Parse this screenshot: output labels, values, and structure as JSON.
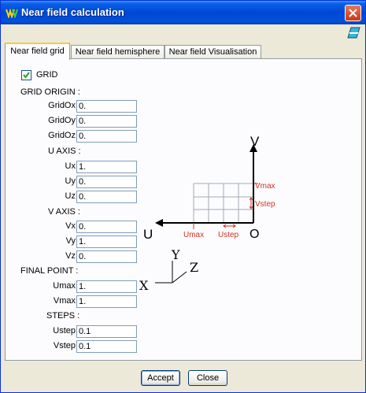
{
  "window": {
    "title": "Near field calculation"
  },
  "tabs": [
    {
      "label": "Near field grid"
    },
    {
      "label": "Near field hemisphere"
    },
    {
      "label": "Near field Visualisation"
    }
  ],
  "grid_checkbox": {
    "label": "GRID",
    "checked": true
  },
  "grid_origin": {
    "heading": "GRID ORIGIN  :",
    "fields": [
      {
        "label": "GridOx",
        "value": "0."
      },
      {
        "label": "GridOy",
        "value": "0."
      },
      {
        "label": "GridOz",
        "value": "0."
      }
    ]
  },
  "u_axis": {
    "heading": "U AXIS  :",
    "fields": [
      {
        "label": "Ux",
        "value": "1."
      },
      {
        "label": "Uy",
        "value": "0."
      },
      {
        "label": "Uz",
        "value": "0."
      }
    ]
  },
  "v_axis": {
    "heading": "V AXIS  :",
    "fields": [
      {
        "label": "Vx",
        "value": "0."
      },
      {
        "label": "Vy",
        "value": "1."
      },
      {
        "label": "Vz",
        "value": "0."
      }
    ]
  },
  "final_point": {
    "heading": "FINAL POINT  :",
    "fields": [
      {
        "label": "Umax",
        "value": "1."
      },
      {
        "label": "Vmax",
        "value": "1."
      }
    ]
  },
  "steps": {
    "heading": "STEPS  :",
    "fields": [
      {
        "label": "Ustep",
        "value": "0.1"
      },
      {
        "label": "Vstep",
        "value": "0.1"
      }
    ]
  },
  "diagram": {
    "v_label": "V",
    "u_label": "U",
    "o_label": "O",
    "vmax_label": "Vmax",
    "vstep_label": "Vstep",
    "umax_label": "Umax",
    "ustep_label": "Ustep",
    "x_label": "X",
    "y_label": "Y",
    "z_label": "Z",
    "annotation_color": "#d83020",
    "grid_color": "#a0aab4"
  },
  "buttons": {
    "accept": "Accept",
    "close": "Close"
  }
}
